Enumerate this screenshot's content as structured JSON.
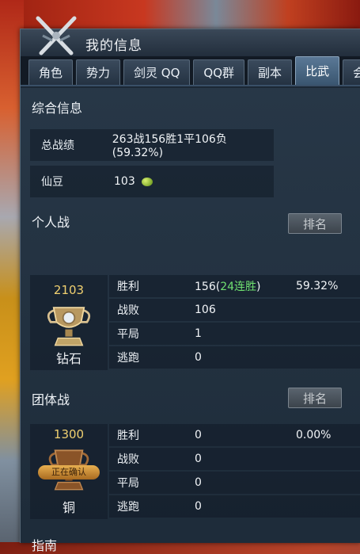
{
  "window": {
    "title": "我的信息"
  },
  "tabs": [
    {
      "label": "角色",
      "active": false
    },
    {
      "label": "势力",
      "active": false
    },
    {
      "label": "剑灵 QQ",
      "active": false
    },
    {
      "label": "QQ群",
      "active": false
    },
    {
      "label": "副本",
      "active": false
    },
    {
      "label": "比武",
      "active": true
    },
    {
      "label": "会",
      "active": false
    }
  ],
  "summary": {
    "title": "综合信息",
    "record_label": "总战绩",
    "record_value": "263战156胜1平106负(59.32%)",
    "beans_label": "仙豆",
    "beans_value": "103",
    "bean_icon": "green-bean-icon"
  },
  "solo": {
    "title": "个人战",
    "rank_button": "排名",
    "score": "2103",
    "tier": "钻石",
    "tier_color": "#c0a060",
    "rows": [
      {
        "label": "胜利",
        "value": "156(",
        "streak": "24连胜",
        "close": ")",
        "pct": "59.32%"
      },
      {
        "label": "战败",
        "value": "106"
      },
      {
        "label": "平局",
        "value": "1"
      },
      {
        "label": "逃跑",
        "value": "0"
      }
    ]
  },
  "team": {
    "title": "团体战",
    "rank_button": "排名",
    "score": "1300",
    "tier": "铜",
    "tier_color": "#a86a30",
    "badge_text": "正在确认",
    "rows": [
      {
        "label": "胜利",
        "value": "0",
        "pct": "0.00%"
      },
      {
        "label": "战败",
        "value": "0"
      },
      {
        "label": "平局",
        "value": "0"
      },
      {
        "label": "逃跑",
        "value": "0"
      }
    ]
  },
  "guide": {
    "title": "指南"
  }
}
